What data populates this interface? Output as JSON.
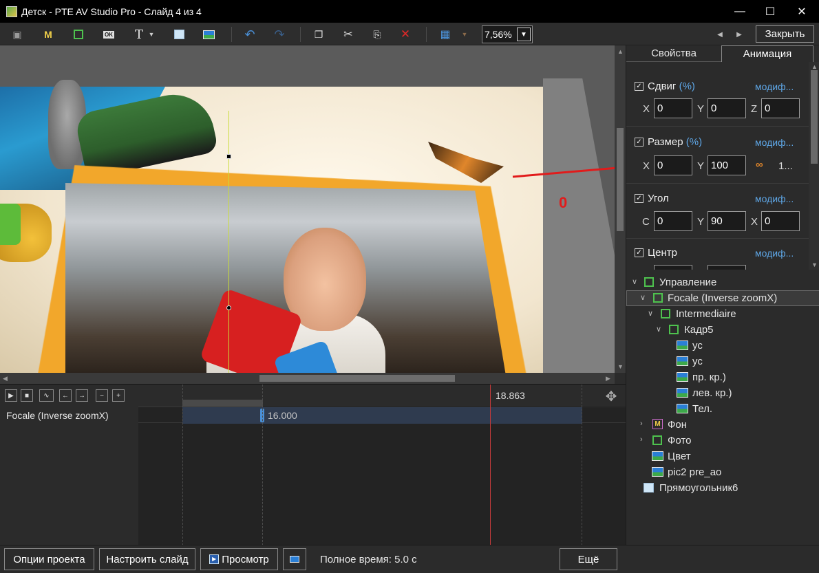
{
  "window": {
    "title": "Детск - PTE AV Studio Pro - Слайд 4 из 4"
  },
  "toolbar": {
    "zoom_value": "7,56%",
    "close_label": "Закрыть",
    "m_label": "M",
    "ok_label": "OK",
    "text_label": "T"
  },
  "preview": {
    "annotation": "0"
  },
  "timeline": {
    "time_marker": "18.863",
    "track_name": "Focale (Inverse zoomX)",
    "keyframe_time": "16.000"
  },
  "right_panel": {
    "tabs": [
      "Свойства",
      "Анимация"
    ],
    "animation": {
      "modify_label": "модиф...",
      "pct_label": "(%)",
      "offset": {
        "title": "Сдвиг",
        "x_label": "X",
        "y_label": "Y",
        "z_label": "Z",
        "x": "0",
        "y": "0",
        "z": "0"
      },
      "size": {
        "title": "Размер",
        "x_label": "X",
        "y_label": "Y",
        "x": "0",
        "y": "100",
        "extra": "1..."
      },
      "angle": {
        "title": "Угол",
        "c_label": "C",
        "y_label": "Y",
        "x_label": "X",
        "c": "0",
        "y": "90",
        "x": "0"
      },
      "center": {
        "title": "Центр"
      }
    },
    "tree": [
      {
        "label": "Управление"
      },
      {
        "label": "Focale (Inverse zoomX)"
      },
      {
        "label": "Intermediaire"
      },
      {
        "label": "Кадр5"
      },
      {
        "label": "ус"
      },
      {
        "label": "ус"
      },
      {
        "label": "пр. кр.)"
      },
      {
        "label": "лев. кр.)"
      },
      {
        "label": "Тел."
      },
      {
        "label": "Фон"
      },
      {
        "label": "Фото"
      },
      {
        "label": "Цвет"
      },
      {
        "label": "pic2 pre_ao"
      },
      {
        "label": "Прямоугольник6"
      }
    ]
  },
  "bottom_bar": {
    "project_options": "Опции проекта",
    "slide_setup": "Настроить слайд",
    "preview": "Просмотр",
    "total_time": "Полное время: 5.0 с",
    "more": "Ещё"
  },
  "colors": {
    "accent_blue": "#5ea6e6",
    "frame_green": "#4ec24e",
    "playhead_red": "#c23a3a",
    "annotation_red": "#e11b1b"
  },
  "icons": [
    "app-icon",
    "camera-icon",
    "frame-icon",
    "picture-icon",
    "undo-icon",
    "redo-icon",
    "copy-icon",
    "cut-icon",
    "paste-icon",
    "delete-icon",
    "grid-icon",
    "move-icon"
  ]
}
